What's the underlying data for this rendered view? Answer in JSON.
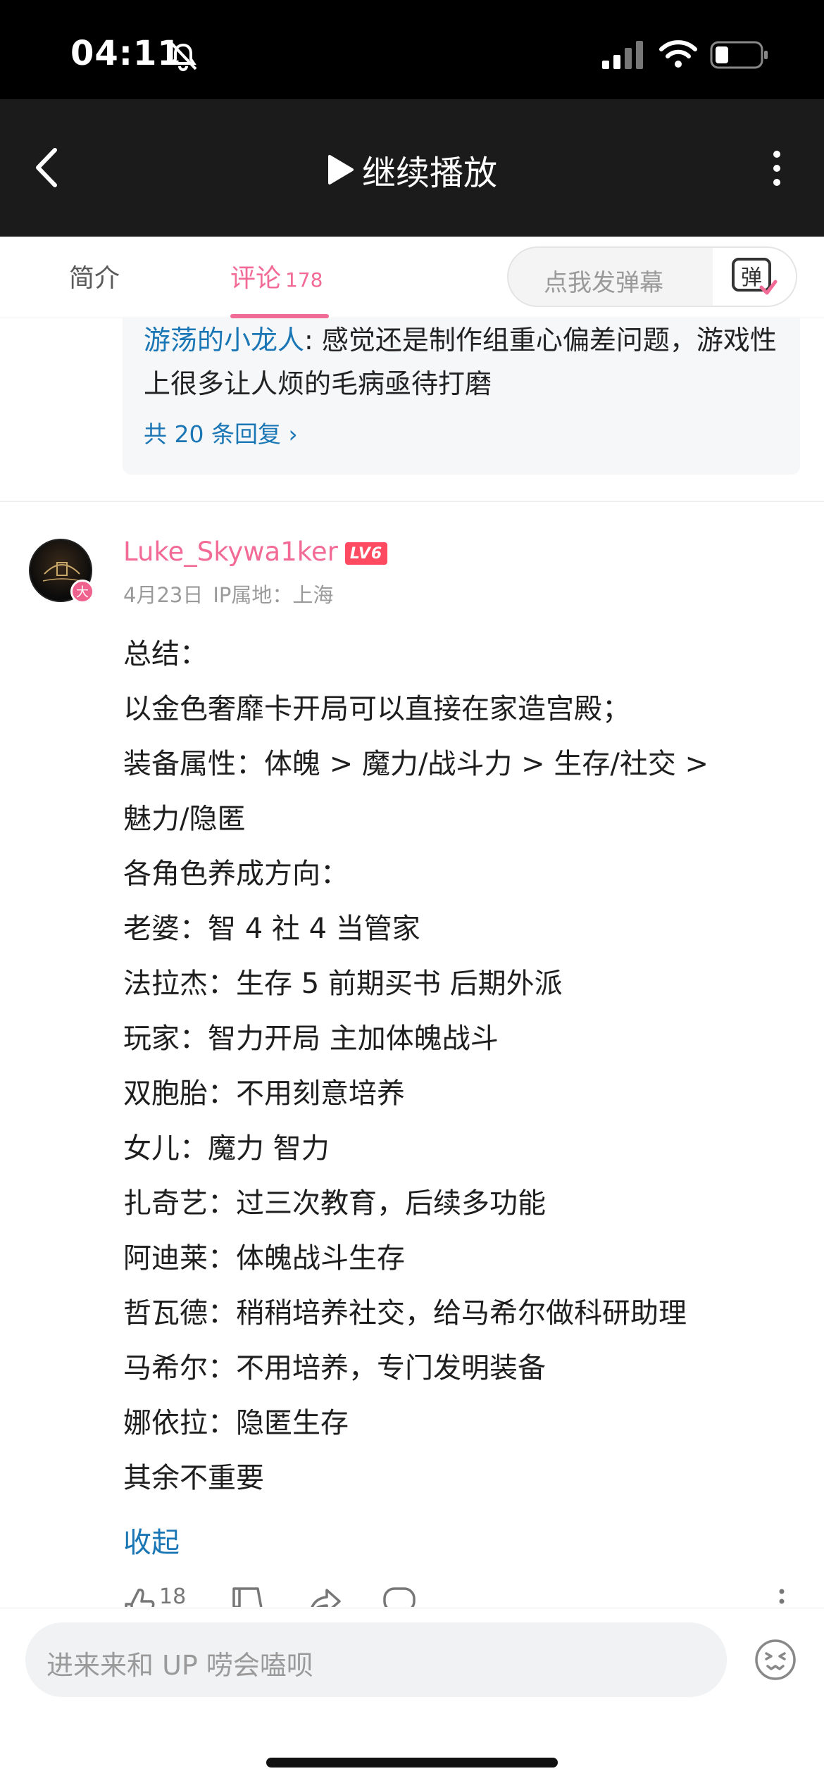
{
  "status_bar": {
    "time": "04:11"
  },
  "header": {
    "continue_label": "继续播放"
  },
  "tabs": {
    "intro_label": "简介",
    "comments_label": "评论",
    "comments_count": "178",
    "danmaku_placeholder": "点我发弹幕",
    "danmaku_button_label": "弹"
  },
  "reply_preview": {
    "user": "游荡的小龙人",
    "text": ": 感觉还是制作组重心偏差问题，游戏性上很多让人烦的毛病亟待打磨",
    "total_replies": "共 20 条回复 ›"
  },
  "comment": {
    "username": "Luke_Skywa1ker",
    "level": "LV6",
    "vip_badge": "大",
    "date": "4月23日",
    "ip_location": "IP属地：上海",
    "lines": [
      "总结：",
      "以金色奢靡卡开局可以直接在家造宫殿；",
      "装备属性：体魄 > 魔力/战斗力 > 生存/社交 >",
      "魅力/隐匿",
      "各角色养成方向：",
      "老婆：智 4 社 4 当管家",
      "法拉杰：生存 5 前期买书 后期外派",
      "玩家：智力开局 主加体魄战斗",
      "双胞胎：不用刻意培养",
      "女儿：魔力 智力",
      "扎奇艺：过三次教育，后续多功能",
      "阿迪莱：体魄战斗生存",
      "哲瓦德：稍稍培养社交，给马希尔做科研助理",
      "马希尔：不用培养，专门发明装备",
      "娜依拉：隐匿生存",
      "其余不重要"
    ],
    "collapse_label": "收起",
    "like_count": "18"
  },
  "bottom": {
    "input_placeholder": "进来来和 UP 唠会嗑呗"
  },
  "colors": {
    "accent_pink": "#f26a96",
    "link_blue": "#1a76b4",
    "level_red": "#ff4b62"
  },
  "icons": [
    "bell-off-icon",
    "signal-icon",
    "wifi-icon",
    "battery-icon",
    "back-icon",
    "play-icon",
    "more-icon",
    "danmaku-icon",
    "like-icon",
    "dislike-icon",
    "share-icon",
    "reply-icon",
    "emoji-icon"
  ]
}
